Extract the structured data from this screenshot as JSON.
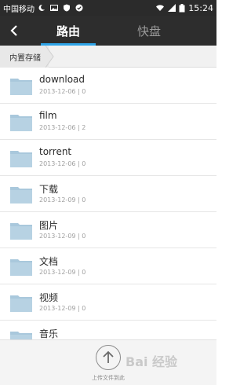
{
  "status_bar": {
    "carrier": "中国移动",
    "time": "15:24"
  },
  "header": {
    "tabs": [
      {
        "label": "路由",
        "active": true
      },
      {
        "label": "快盘",
        "active": false
      }
    ]
  },
  "breadcrumb": {
    "path": "内置存储"
  },
  "files": [
    {
      "name": "download",
      "meta": "2013-12-06 | 0"
    },
    {
      "name": "film",
      "meta": "2013-12-06 | 2"
    },
    {
      "name": "torrent",
      "meta": "2013-12-06 | 0"
    },
    {
      "name": "下载",
      "meta": "2013-12-09 | 0"
    },
    {
      "name": "图片",
      "meta": "2013-12-09 | 0"
    },
    {
      "name": "文档",
      "meta": "2013-12-09 | 0"
    },
    {
      "name": "视频",
      "meta": "2013-12-09 | 0"
    },
    {
      "name": "音乐",
      "meta": ""
    }
  ],
  "bottom_bar": {
    "upload_label": "上传文件到此",
    "watermark": "Bai 经验"
  },
  "colors": {
    "accent": "#2fa4e7",
    "folder": "#a9c8dc",
    "header_bg": "#2d2d2d"
  },
  "icons": {
    "back": "chevron-left-icon",
    "upload": "arrow-up-icon",
    "folder": "folder-icon"
  }
}
